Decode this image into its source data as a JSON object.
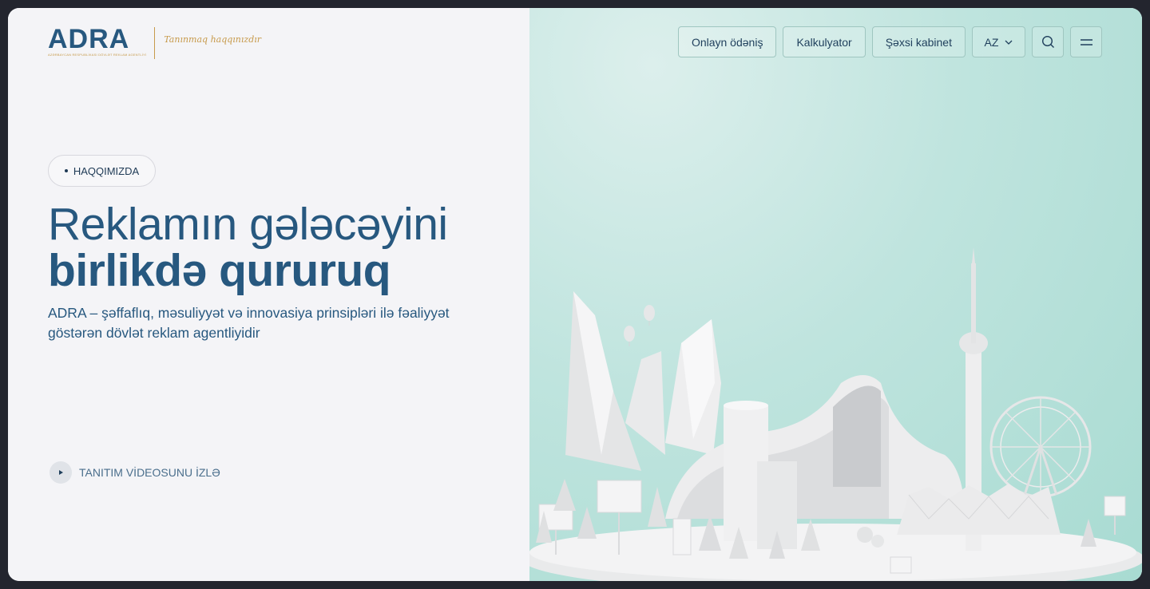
{
  "brand": {
    "logo_text": "ADRA",
    "logo_subtext": "AZƏRBAYCAN RESPUBLİKASI DÖVLƏT REKLAM AGENTLİYİ",
    "slogan": "Tanınmaq haqqınızdır",
    "colors": {
      "primary": "#27587f",
      "accent": "#c79a4b"
    }
  },
  "nav": {
    "online_payment": "Onlayn ödəniş",
    "calculator": "Kalkulyator",
    "personal_cabinet": "Şəxsi kabinet",
    "language": "AZ",
    "search_icon": "search-icon",
    "menu_icon": "menu-icon"
  },
  "hero": {
    "badge": "HAQQIMIZDA",
    "title_line1": "Reklamın gələcəyini",
    "title_line2": "birlikdə qururuq",
    "description": "ADRA – şəffaflıq, məsuliyyət və innovasiya prinsipləri ilə fəaliyyət göstərən dövlət reklam agentliyidir",
    "video_link": "TANITIM VİDEOSUNU İZLƏ"
  }
}
